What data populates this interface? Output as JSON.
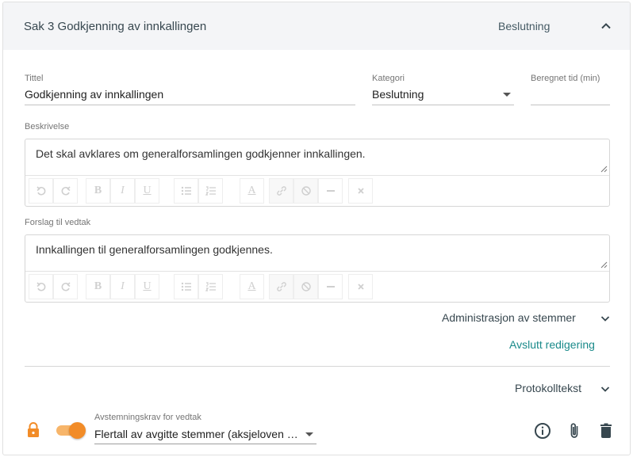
{
  "header": {
    "title": "Sak 3 Godkjenning av innkallingen",
    "category": "Beslutning"
  },
  "form": {
    "title_label": "Tittel",
    "title_value": "Godkjenning av innkallingen",
    "category_label": "Kategori",
    "category_value": "Beslutning",
    "time_label": "Beregnet tid (min)",
    "time_value": ""
  },
  "description": {
    "label": "Beskrivelse",
    "text": "Det skal avklares om generalforsamlingen godkjenner innkallingen."
  },
  "proposal": {
    "label": "Forslag til vedtak",
    "text": "Innkallingen til generalforsamlingen godkjennes."
  },
  "toolbar": {
    "icons": [
      "undo-icon",
      "redo-icon",
      "bold-icon",
      "italic-icon",
      "underline-icon",
      "bullet-list-icon",
      "numbered-list-icon",
      "text-color-icon",
      "link-icon",
      "unlink-icon",
      "horizontal-rule-icon",
      "clear-format-icon"
    ]
  },
  "sections": {
    "votes_admin": "Administrasjon av stemmer",
    "finish_editing": "Avslutt redigering",
    "protocol_text": "Protokolltekst"
  },
  "footer": {
    "voting_label": "Avstemningskrav for vedtak",
    "voting_value": "Flertall av avgitte stemmer (aksjeloven §...",
    "toggle_on": true
  },
  "colors": {
    "accent": "#f28c28",
    "link": "#1a8a8a",
    "header_bg": "#f4f5f7"
  }
}
